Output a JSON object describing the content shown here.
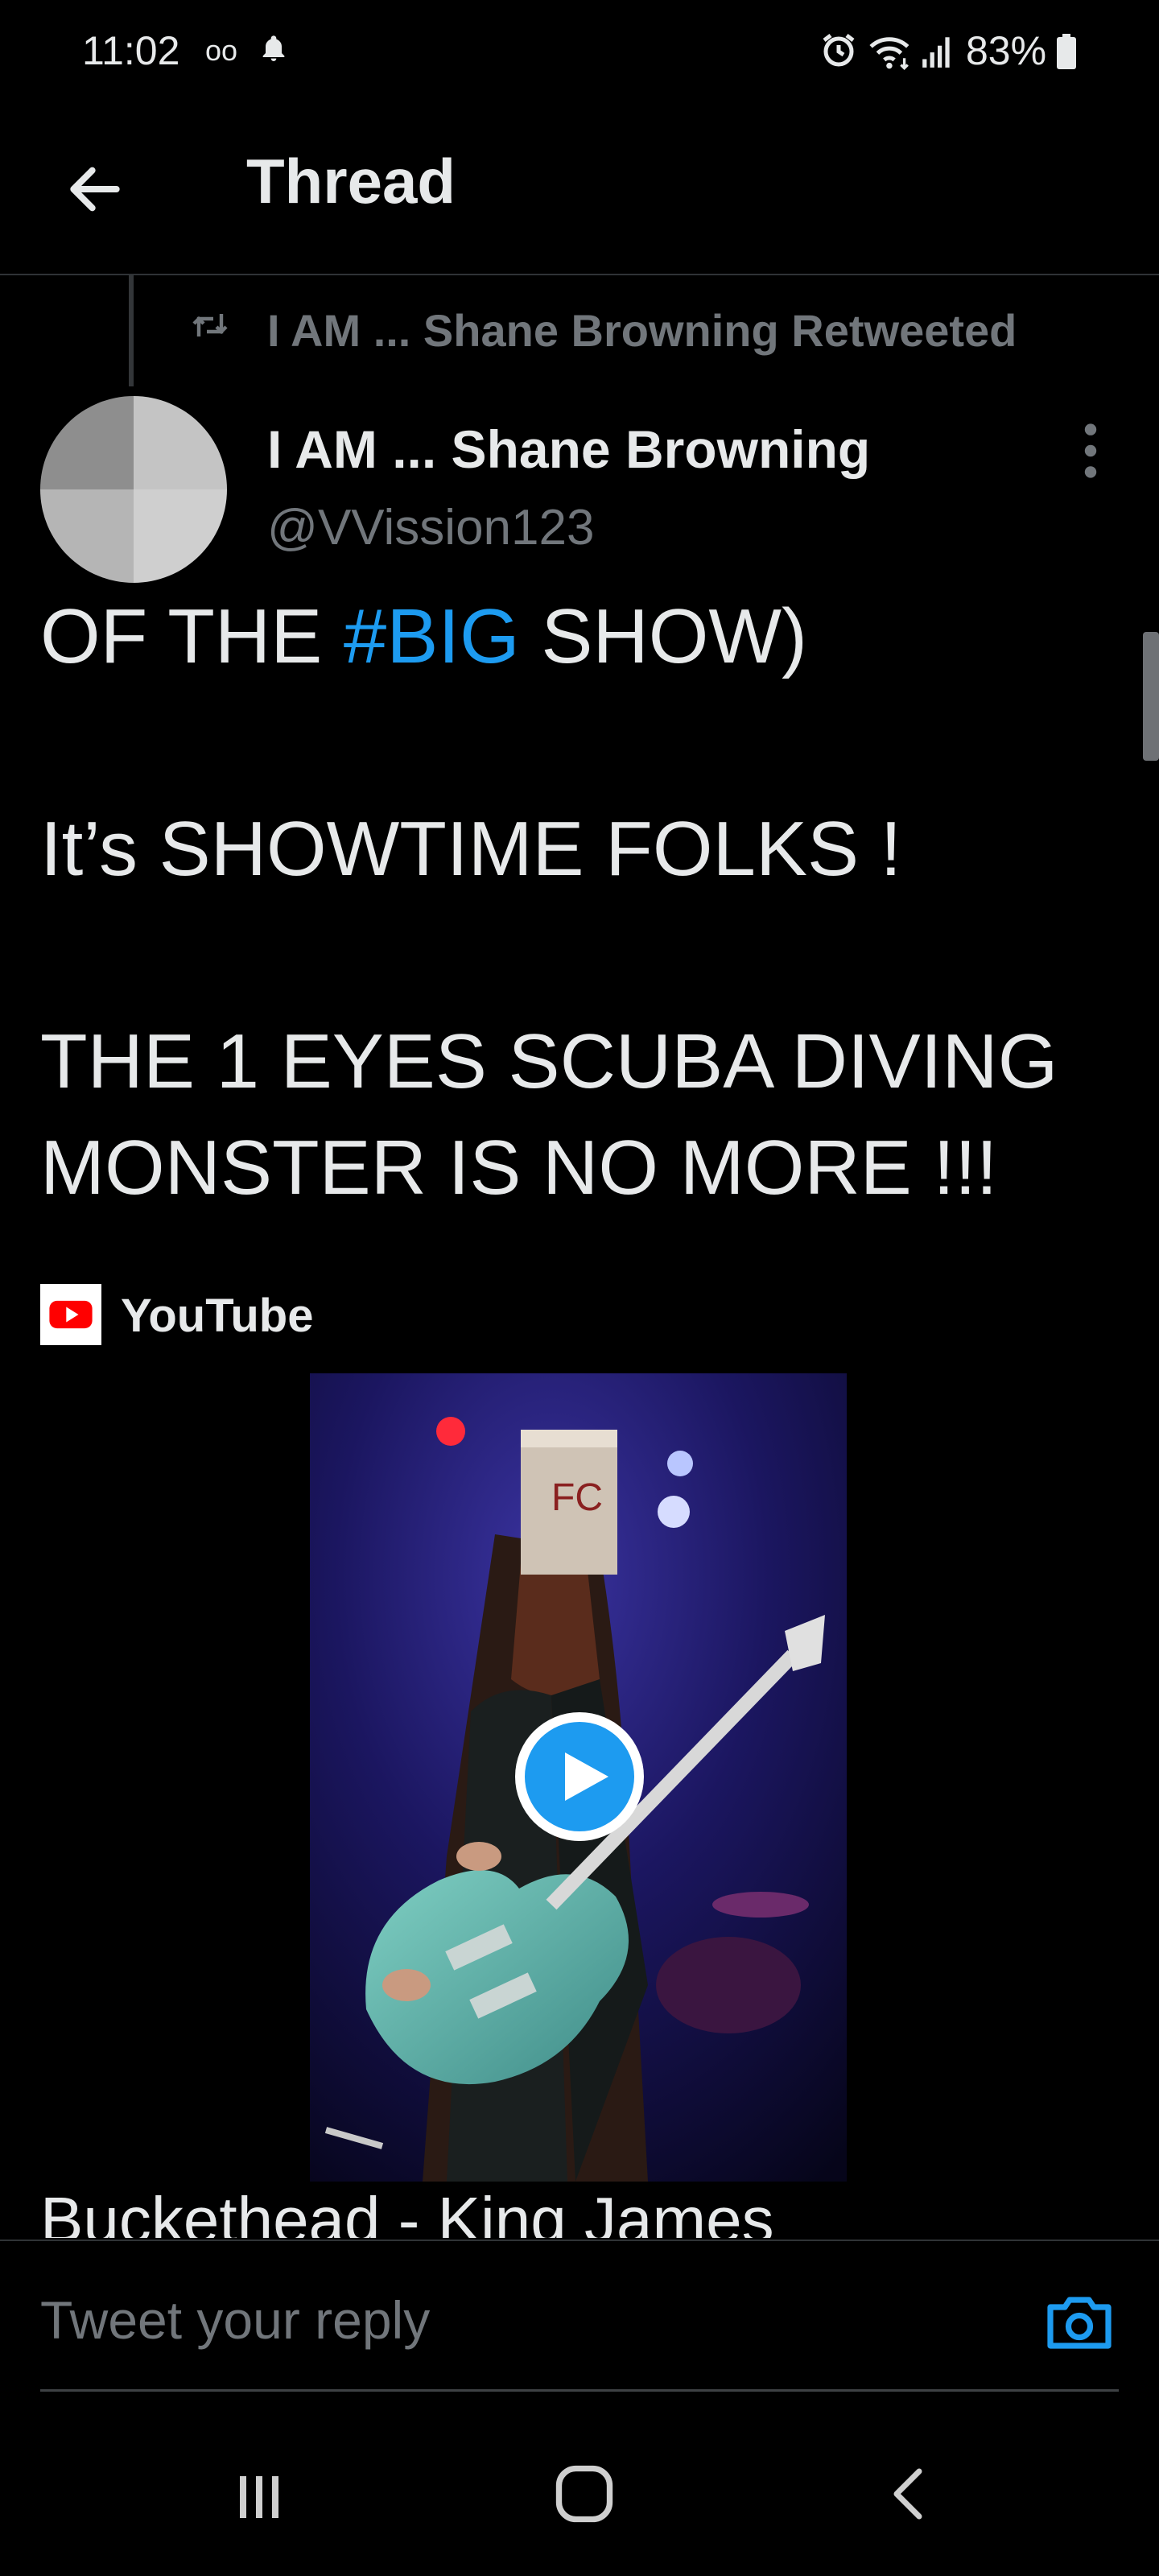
{
  "status_bar": {
    "time": "11:02",
    "voicemail_icon": "oo",
    "battery_percent": "83%"
  },
  "header": {
    "title": "Thread"
  },
  "retweet": {
    "label": "I AM ... Shane Browning Retweeted"
  },
  "tweet": {
    "author_name": "I AM ... Shane Browning",
    "author_handle": "@VVission123",
    "line1_prefix": "OF THE ",
    "line1_hashtag": "#BIG",
    "line1_suffix": " SHOW)",
    "line2": "It’s SHOWTIME FOLKS !",
    "line3": "THE 1 EYES SCUBA DIVING MONSTER IS NO MORE !!!"
  },
  "link_card": {
    "source": "YouTube",
    "title": "Buckethead - King James"
  },
  "reply": {
    "placeholder": "Tweet your reply"
  },
  "colors": {
    "background": "#000000",
    "accent": "#1d9bf0",
    "secondary_text": "#71767b",
    "youtube_red": "#ff0000"
  }
}
